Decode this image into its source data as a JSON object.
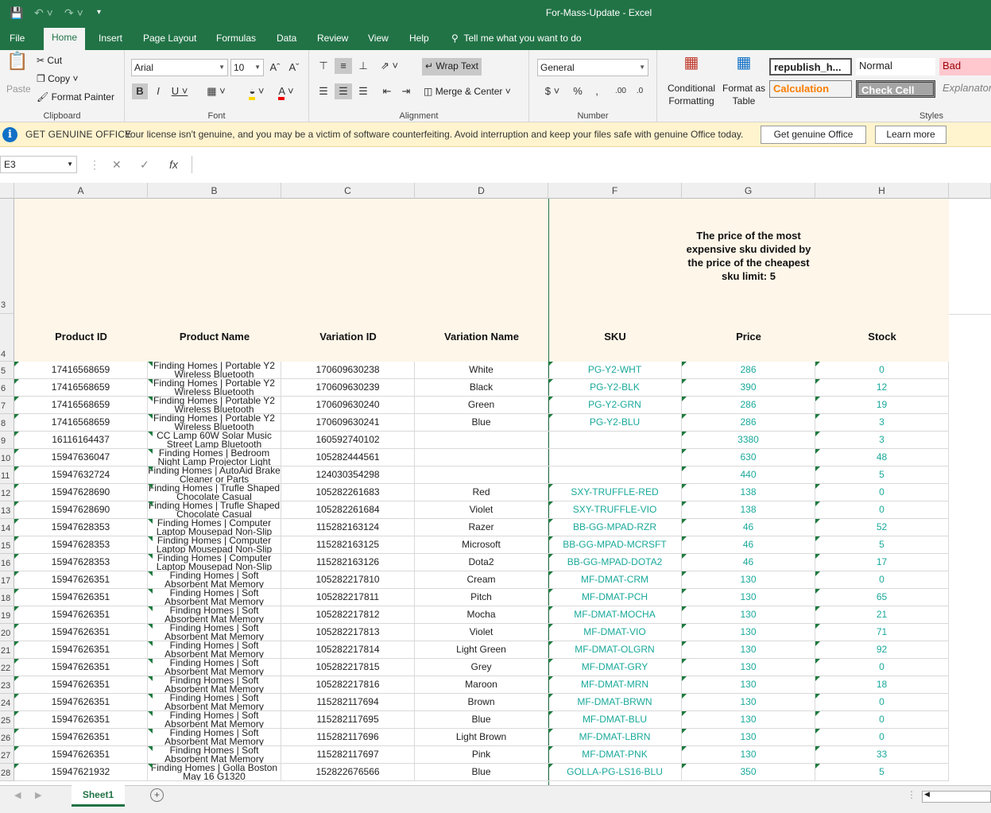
{
  "window": {
    "title": "For-Mass-Update  -  Excel"
  },
  "tabs": [
    "File",
    "Home",
    "Insert",
    "Page Layout",
    "Formulas",
    "Data",
    "Review",
    "View",
    "Help"
  ],
  "tell_me": "Tell me what you want to do",
  "clipboard": {
    "paste": "Paste",
    "cut": "Cut",
    "copy": "Copy",
    "format_painter": "Format Painter",
    "label": "Clipboard"
  },
  "font": {
    "name": "Arial",
    "size": "10",
    "label": "Font"
  },
  "alignment": {
    "wrap_text": "Wrap Text",
    "merge_center": "Merge & Center",
    "label": "Alignment"
  },
  "number": {
    "format": "General",
    "label": "Number"
  },
  "styles": {
    "conditional_formatting": "Conditional Formatting",
    "format_as_table": "Format as Table",
    "cells": [
      "republish_h...",
      "Normal",
      "Bad",
      "Calculation",
      "Check Cell",
      "Explanatory"
    ],
    "label": "Styles"
  },
  "infobar": {
    "lead": "GET GENUINE OFFICE",
    "message": "Your license isn't genuine, and you may be a victim of software counterfeiting. Avoid interruption and keep your files safe with genuine Office today.",
    "get_button": "Get genuine Office",
    "learn_button": "Learn more"
  },
  "formula_bar": {
    "name_box": "E3",
    "formula": ""
  },
  "columns": [
    "A",
    "B",
    "C",
    "D",
    "F",
    "G",
    "H"
  ],
  "row_numbers": [
    "3",
    "4",
    "5",
    "6",
    "7",
    "8",
    "9",
    "10",
    "11",
    "12",
    "13",
    "14",
    "15",
    "16",
    "17",
    "18",
    "19",
    "20",
    "21",
    "22",
    "23",
    "24",
    "25",
    "26",
    "27",
    "28"
  ],
  "header_note": "The price of the most expensive sku divided by the price of the cheapest sku limit: 5",
  "headers": [
    "Product ID",
    "Product Name",
    "Variation ID",
    "Variation Name",
    "SKU",
    "Price",
    "Stock"
  ],
  "rows": [
    {
      "pid": "17416568659",
      "name": "Finding Homes | Portable Y2 Wireless Bluetooth",
      "vid": "170609630238",
      "vname": "White",
      "sku": "PG-Y2-WHT",
      "price": "286",
      "stock": "0"
    },
    {
      "pid": "17416568659",
      "name": "Finding Homes | Portable Y2 Wireless Bluetooth",
      "vid": "170609630239",
      "vname": "Black",
      "sku": "PG-Y2-BLK",
      "price": "390",
      "stock": "12"
    },
    {
      "pid": "17416568659",
      "name": "Finding Homes | Portable Y2 Wireless Bluetooth",
      "vid": "170609630240",
      "vname": "Green",
      "sku": "PG-Y2-GRN",
      "price": "286",
      "stock": "19"
    },
    {
      "pid": "17416568659",
      "name": "Finding Homes | Portable Y2 Wireless Bluetooth",
      "vid": "170609630241",
      "vname": "Blue",
      "sku": "PG-Y2-BLU",
      "price": "286",
      "stock": "3"
    },
    {
      "pid": "16116164437",
      "name": "CC Lamp 60W Solar Music Street Lamp Bluetooth",
      "vid": "160592740102",
      "vname": "",
      "sku": "",
      "price": "3380",
      "stock": "3"
    },
    {
      "pid": "15947636047",
      "name": "Finding Homes | Bedroom Night Lamp Projector Light",
      "vid": "105282444561",
      "vname": "",
      "sku": "",
      "price": "630",
      "stock": "48"
    },
    {
      "pid": "15947632724",
      "name": "Finding Homes | AutoAid Brake Cleaner or Parts",
      "vid": "124030354298",
      "vname": "",
      "sku": "",
      "price": "440",
      "stock": "5"
    },
    {
      "pid": "15947628690",
      "name": "Finding Homes | Trufle Shaped Chocolate Casual",
      "vid": "105282261683",
      "vname": "Red",
      "sku": "SXY-TRUFFLE-RED",
      "price": "138",
      "stock": "0"
    },
    {
      "pid": "15947628690",
      "name": "Finding Homes | Trufle Shaped Chocolate Casual",
      "vid": "105282261684",
      "vname": "Violet",
      "sku": "SXY-TRUFFLE-VIO",
      "price": "138",
      "stock": "0"
    },
    {
      "pid": "15947628353",
      "name": "Finding Homes | Computer Laptop Mousepad Non-Slip",
      "vid": "115282163124",
      "vname": "Razer",
      "sku": "BB-GG-MPAD-RZR",
      "price": "46",
      "stock": "52"
    },
    {
      "pid": "15947628353",
      "name": "Finding Homes | Computer Laptop Mousepad Non-Slip",
      "vid": "115282163125",
      "vname": "Microsoft",
      "sku": "BB-GG-MPAD-MCRSFT",
      "price": "46",
      "stock": "5"
    },
    {
      "pid": "15947628353",
      "name": "Finding Homes | Computer Laptop Mousepad Non-Slip",
      "vid": "115282163126",
      "vname": "Dota2",
      "sku": "BB-GG-MPAD-DOTA2",
      "price": "46",
      "stock": "17"
    },
    {
      "pid": "15947626351",
      "name": "Finding Homes | Soft Absorbent Mat Memory",
      "vid": "105282217810",
      "vname": "Cream",
      "sku": "MF-DMAT-CRM",
      "price": "130",
      "stock": "0"
    },
    {
      "pid": "15947626351",
      "name": "Finding Homes | Soft Absorbent Mat Memory",
      "vid": "105282217811",
      "vname": "Pitch",
      "sku": "MF-DMAT-PCH",
      "price": "130",
      "stock": "65"
    },
    {
      "pid": "15947626351",
      "name": "Finding Homes | Soft Absorbent Mat Memory",
      "vid": "105282217812",
      "vname": "Mocha",
      "sku": "MF-DMAT-MOCHA",
      "price": "130",
      "stock": "21"
    },
    {
      "pid": "15947626351",
      "name": "Finding Homes | Soft Absorbent Mat Memory",
      "vid": "105282217813",
      "vname": "Violet",
      "sku": "MF-DMAT-VIO",
      "price": "130",
      "stock": "71"
    },
    {
      "pid": "15947626351",
      "name": "Finding Homes | Soft Absorbent Mat Memory",
      "vid": "105282217814",
      "vname": "Light Green",
      "sku": "MF-DMAT-OLGRN",
      "price": "130",
      "stock": "92"
    },
    {
      "pid": "15947626351",
      "name": "Finding Homes | Soft Absorbent Mat Memory",
      "vid": "105282217815",
      "vname": "Grey",
      "sku": "MF-DMAT-GRY",
      "price": "130",
      "stock": "0"
    },
    {
      "pid": "15947626351",
      "name": "Finding Homes | Soft Absorbent Mat Memory",
      "vid": "105282217816",
      "vname": "Maroon",
      "sku": "MF-DMAT-MRN",
      "price": "130",
      "stock": "18"
    },
    {
      "pid": "15947626351",
      "name": "Finding Homes | Soft Absorbent Mat Memory",
      "vid": "115282117694",
      "vname": "Brown",
      "sku": "MF-DMAT-BRWN",
      "price": "130",
      "stock": "0"
    },
    {
      "pid": "15947626351",
      "name": "Finding Homes | Soft Absorbent Mat Memory",
      "vid": "115282117695",
      "vname": "Blue",
      "sku": "MF-DMAT-BLU",
      "price": "130",
      "stock": "0"
    },
    {
      "pid": "15947626351",
      "name": "Finding Homes | Soft Absorbent Mat Memory",
      "vid": "115282117696",
      "vname": "Light Brown",
      "sku": "MF-DMAT-LBRN",
      "price": "130",
      "stock": "0"
    },
    {
      "pid": "15947626351",
      "name": "Finding Homes | Soft Absorbent Mat Memory",
      "vid": "115282117697",
      "vname": "Pink",
      "sku": "MF-DMAT-PNK",
      "price": "130",
      "stock": "33"
    },
    {
      "pid": "15947621932",
      "name": "Finding Homes | Golla Boston May 16 G1320",
      "vid": "152822676566",
      "vname": "Blue",
      "sku": "GOLLA-PG-LS16-BLU",
      "price": "350",
      "stock": "5"
    }
  ],
  "sheet_tab": "Sheet1",
  "colors": {
    "excel_green": "#217346",
    "sku_text": "#1aa99b",
    "header_fill": "#fdf6e9"
  }
}
